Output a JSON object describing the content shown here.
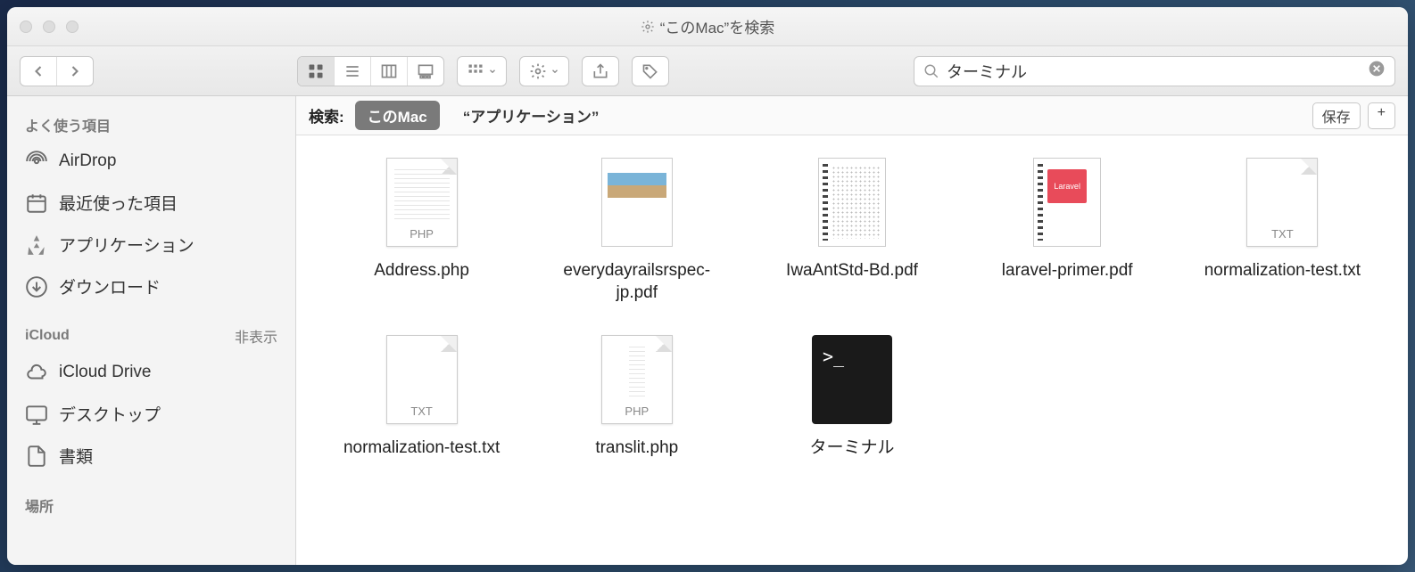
{
  "window": {
    "title": "“このMac”を検索"
  },
  "search": {
    "value": "ターミナル"
  },
  "sidebar": {
    "favorites_header": "よく使う項目",
    "items": [
      {
        "label": "AirDrop",
        "icon": "airdrop"
      },
      {
        "label": "最近使った項目",
        "icon": "clock"
      },
      {
        "label": "アプリケーション",
        "icon": "apps"
      },
      {
        "label": "ダウンロード",
        "icon": "download"
      }
    ],
    "icloud_header": "iCloud",
    "icloud_toggle": "非表示",
    "icloud_items": [
      {
        "label": "iCloud Drive",
        "icon": "cloud"
      },
      {
        "label": "デスクトップ",
        "icon": "desktop"
      },
      {
        "label": "書類",
        "icon": "document"
      }
    ],
    "locations_header": "場所"
  },
  "scope": {
    "label": "検索:",
    "this_mac": "このMac",
    "applications": "“アプリケーション”",
    "save": "保存"
  },
  "files": [
    {
      "name": "Address.php",
      "type": "php"
    },
    {
      "name": "everydayrailsrspec-jp.pdf",
      "type": "rails-pdf"
    },
    {
      "name": "IwaAntStd-Bd.pdf",
      "type": "spiral-pdf"
    },
    {
      "name": "laravel-primer.pdf",
      "type": "laravel-pdf"
    },
    {
      "name": "normalization-test.txt",
      "type": "txt"
    },
    {
      "name": "normalization-test.txt",
      "type": "txt"
    },
    {
      "name": "translit.php",
      "type": "php"
    },
    {
      "name": "ターミナル",
      "type": "terminal"
    }
  ],
  "badges": {
    "php": "PHP",
    "txt": "TXT",
    "laravel": "Laravel"
  }
}
